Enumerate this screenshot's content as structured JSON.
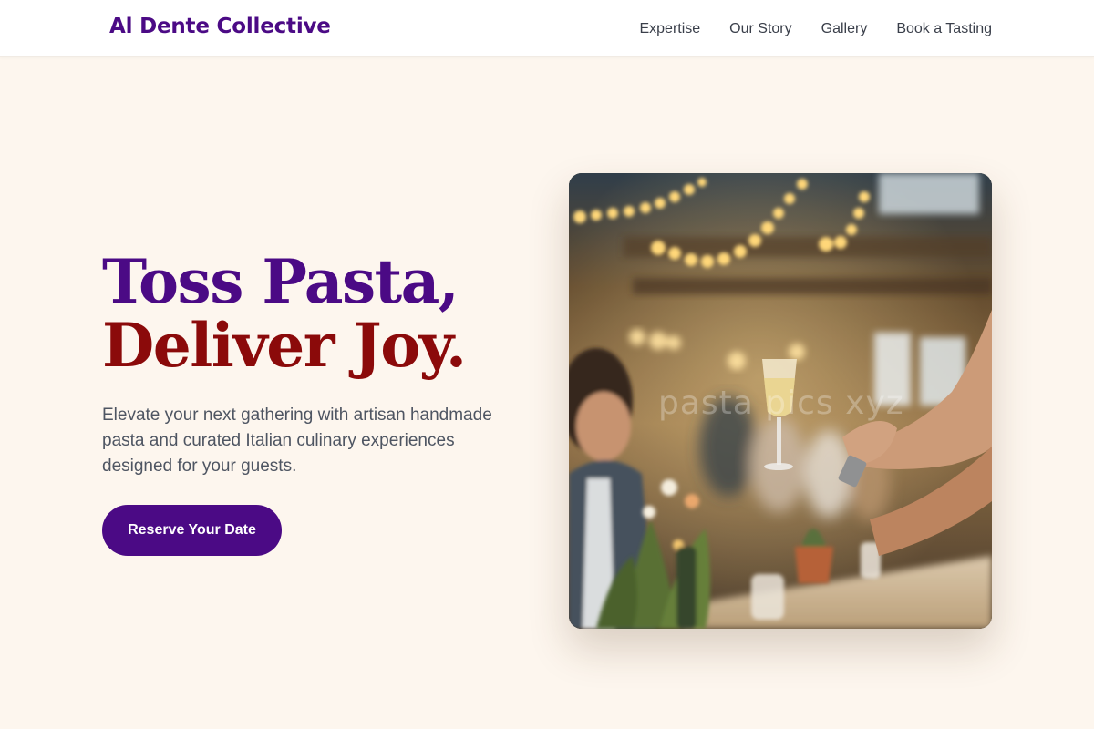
{
  "nav": {
    "brand": "Al Dente Collective",
    "links": [
      "Expertise",
      "Our Story",
      "Gallery",
      "Book a Tasting"
    ]
  },
  "hero": {
    "headline_line1": "Toss Pasta,",
    "headline_line2": "Deliver Joy.",
    "subtext": "Elevate your next gathering with artisan handmade pasta and curated Italian culinary experiences designed for your guests.",
    "cta_label": "Reserve Your Date"
  },
  "image": {
    "alt": "Guests raising champagne glasses at a long banquet table under string lights",
    "watermark": "pasta pics xyz"
  },
  "colors": {
    "brand_purple": "#4b0a85",
    "headline_red": "#8b0a0a",
    "page_background": "#fdf6ee",
    "body_text": "#4e5562"
  }
}
